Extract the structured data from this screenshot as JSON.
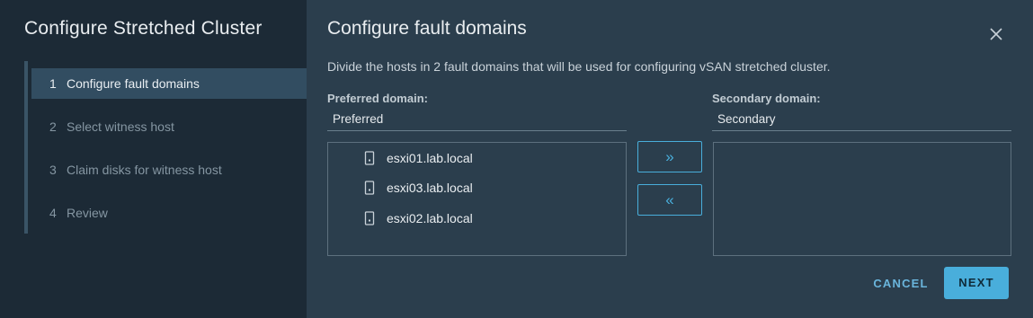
{
  "wizard": {
    "title": "Configure Stretched Cluster",
    "steps": [
      {
        "num": "1",
        "label": "Configure fault domains"
      },
      {
        "num": "2",
        "label": "Select witness host"
      },
      {
        "num": "3",
        "label": "Claim disks for witness host"
      },
      {
        "num": "4",
        "label": "Review"
      }
    ],
    "active_step": 0
  },
  "page": {
    "title": "Configure fault domains",
    "description": "Divide the hosts in 2 fault domains that will be used for configuring vSAN stretched cluster."
  },
  "preferred": {
    "label": "Preferred domain:",
    "name": "Preferred",
    "hosts": [
      "esxi01.lab.local",
      "esxi03.lab.local",
      "esxi02.lab.local"
    ]
  },
  "secondary": {
    "label": "Secondary domain:",
    "name": "Secondary",
    "hosts": []
  },
  "move": {
    "right_glyph": "»",
    "left_glyph": "«"
  },
  "footer": {
    "cancel_label": "CANCEL",
    "next_label": "NEXT"
  },
  "colors": {
    "accent": "#49aedb",
    "sidebar_bg": "#1c2a36",
    "content_bg": "#2b3e4d",
    "active_step_bg": "#324d61"
  }
}
